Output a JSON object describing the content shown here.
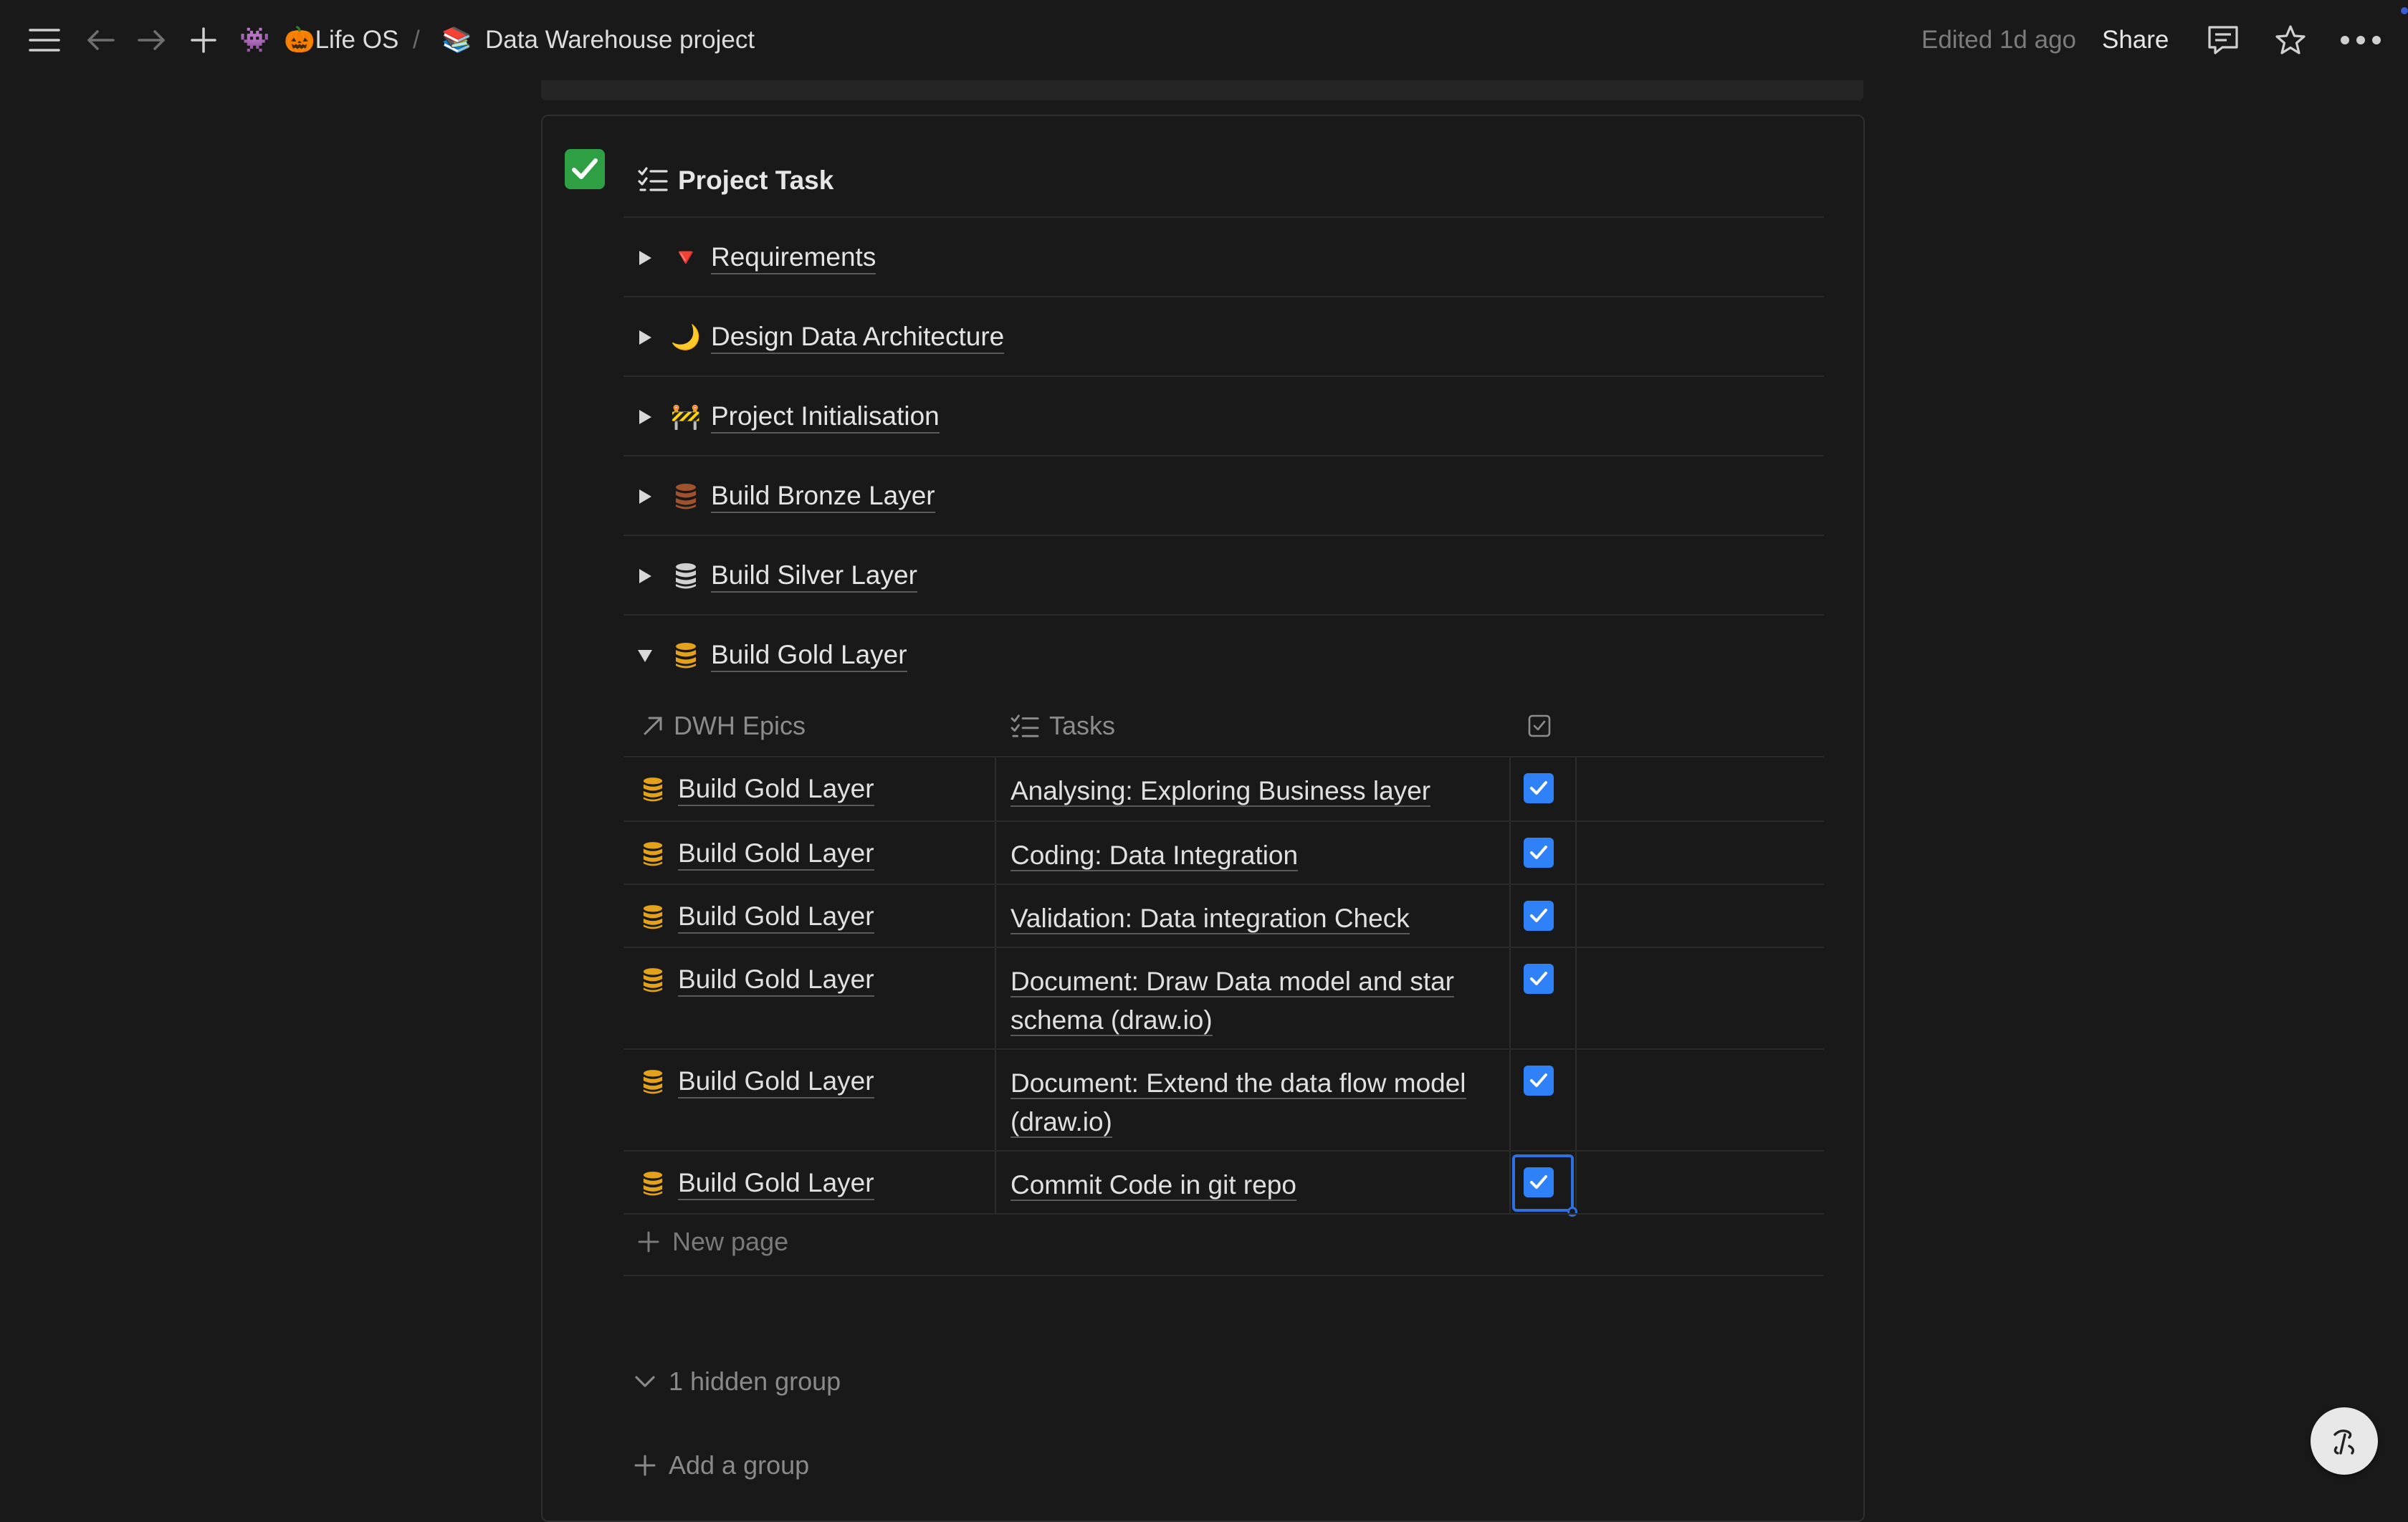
{
  "topbar": {
    "workspace_emoji": "👾",
    "breadcrumb_root": "🎃Life OS",
    "separator": "/",
    "page_emoji": "📚",
    "page_title": "Data Warehouse project",
    "edited": "Edited 1d ago",
    "share": "Share"
  },
  "database": {
    "callout_icon": "check-mark-icon",
    "title": "Project Task",
    "groups": [
      {
        "emoji": "🔻",
        "label": "Requirements",
        "expanded": false
      },
      {
        "emoji": "🌙",
        "label": "Design Data Architecture",
        "expanded": false
      },
      {
        "emoji": "🚧",
        "label": "Project Initialisation",
        "expanded": false
      },
      {
        "emoji": "database-icon",
        "color": "#a0522d",
        "label": "Build Bronze Layer",
        "expanded": false
      },
      {
        "emoji": "database-icon",
        "color": "#d0d0d0",
        "label": "Build Silver Layer",
        "expanded": false
      },
      {
        "emoji": "database-icon",
        "color": "#e3a21a",
        "label": "Build Gold Layer",
        "expanded": true
      }
    ],
    "columns": {
      "epics": "DWH Epics",
      "tasks": "Tasks"
    },
    "rows": [
      {
        "epic": "Build Gold Layer",
        "task": "Analysing: Exploring Business layer",
        "done": true
      },
      {
        "epic": "Build Gold Layer",
        "task": "Coding: Data Integration",
        "done": true
      },
      {
        "epic": "Build Gold Layer",
        "task": "Validation: Data integration Check",
        "done": true
      },
      {
        "epic": "Build Gold Layer",
        "task": "Document: Draw Data model and star schema (draw.io)",
        "done": true
      },
      {
        "epic": "Build Gold Layer",
        "task": "Document: Extend the data flow model (draw.io)",
        "done": true
      },
      {
        "epic": "Build Gold Layer",
        "task": "Commit Code in git repo",
        "done": true
      }
    ],
    "new_page": "New page",
    "hidden_group": "1 hidden group",
    "add_group": "Add a group"
  }
}
